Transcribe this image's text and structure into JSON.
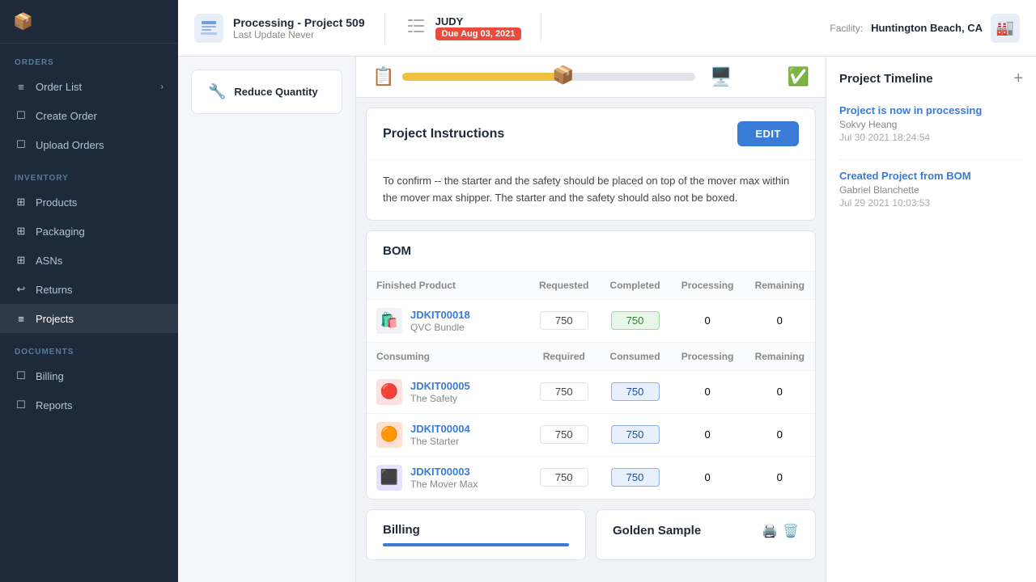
{
  "sidebar": {
    "orders_label": "ORDERS",
    "inventory_label": "INVENTORY",
    "documents_label": "DOCUMENTS",
    "items": [
      {
        "id": "order-list",
        "label": "Order List",
        "hasArrow": true
      },
      {
        "id": "create-order",
        "label": "Create Order"
      },
      {
        "id": "upload-orders",
        "label": "Upload Orders"
      },
      {
        "id": "products",
        "label": "Products"
      },
      {
        "id": "packaging",
        "label": "Packaging"
      },
      {
        "id": "asns",
        "label": "ASNs"
      },
      {
        "id": "returns",
        "label": "Returns"
      },
      {
        "id": "projects",
        "label": "Projects",
        "active": true
      },
      {
        "id": "billing",
        "label": "Billing"
      },
      {
        "id": "reports",
        "label": "Reports"
      }
    ]
  },
  "topbar": {
    "project_title": "Processing - Project 509",
    "last_update_label": "Last Update",
    "last_update_value": "Never",
    "assignee": "JUDY",
    "due_label": "Due Aug 03, 2021",
    "facility_label": "Facility:",
    "facility_name": "Huntington Beach, CA"
  },
  "reduce_quantity": {
    "label": "Reduce Quantity"
  },
  "instructions": {
    "section_title": "Project Instructions",
    "edit_button": "EDIT",
    "text": "To confirm -- the starter and the safety should be placed on top of the mover max within the mover max shipper. The starter and the safety should also not be boxed."
  },
  "bom": {
    "section_title": "BOM",
    "finished_product_col": "Finished Product",
    "requested_col": "Requested",
    "completed_col": "Completed",
    "processing_col": "Processing",
    "remaining_col": "Remaining",
    "consuming_col": "Consuming",
    "required_col": "Required",
    "consumed_col": "Consumed",
    "finished_rows": [
      {
        "id": "JDKIT00018",
        "name": "QVC Bundle",
        "requested": "750",
        "completed": "750",
        "processing": "0",
        "remaining": "0",
        "completed_highlight": true
      }
    ],
    "consuming_rows": [
      {
        "id": "JDKIT00005",
        "name": "The Safety",
        "required": "750",
        "consumed": "750",
        "processing": "0",
        "remaining": "0"
      },
      {
        "id": "JDKIT00004",
        "name": "The Starter",
        "required": "750",
        "consumed": "750",
        "processing": "0",
        "remaining": "0"
      },
      {
        "id": "JDKIT00003",
        "name": "The Mover Max",
        "required": "750",
        "consumed": "750",
        "processing": "0",
        "remaining": "0"
      }
    ]
  },
  "billing": {
    "title": "Billing"
  },
  "golden_sample": {
    "title": "Golden Sample"
  },
  "timeline": {
    "title": "Project Timeline",
    "events": [
      {
        "event": "Project is now in processing",
        "user": "Sokvy Heang",
        "date": "Jul 30 2021 18:24:54"
      },
      {
        "event": "Created Project from BOM",
        "user": "Gabriel Blanchette",
        "date": "Jul 29 2021 10:03:53"
      }
    ]
  }
}
